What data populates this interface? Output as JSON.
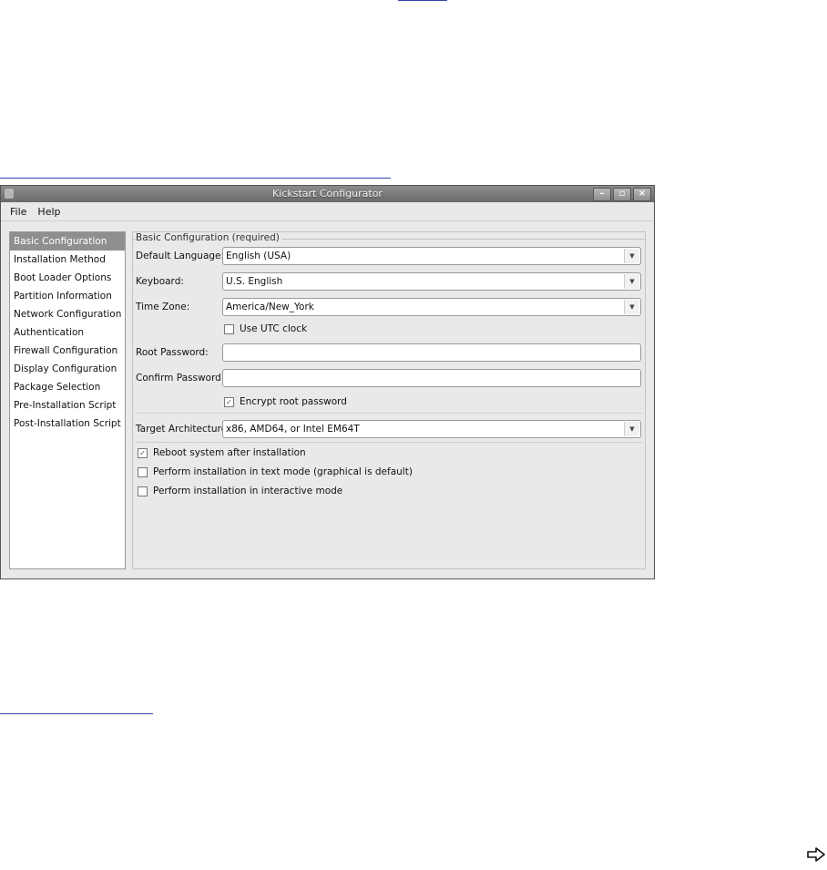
{
  "window": {
    "title": "Kickstart Configurator",
    "controls": [
      "minimize-icon",
      "maximize-icon",
      "close-icon"
    ]
  },
  "menu": {
    "file": "File",
    "help": "Help"
  },
  "sidebar": {
    "items": [
      {
        "label": "Basic Configuration",
        "selected": true
      },
      {
        "label": "Installation Method"
      },
      {
        "label": "Boot Loader Options"
      },
      {
        "label": "Partition Information"
      },
      {
        "label": "Network Configuration"
      },
      {
        "label": "Authentication"
      },
      {
        "label": "Firewall Configuration"
      },
      {
        "label": "Display Configuration"
      },
      {
        "label": "Package Selection"
      },
      {
        "label": "Pre-Installation Script"
      },
      {
        "label": "Post-Installation Script"
      }
    ]
  },
  "basic": {
    "group_title": "Basic Configuration (required)",
    "default_language": {
      "label": "Default Language:",
      "value": "English (USA)"
    },
    "keyboard": {
      "label": "Keyboard:",
      "value": "U.S. English"
    },
    "time_zone": {
      "label": "Time Zone:",
      "value": "America/New_York"
    },
    "utc_clock": {
      "label": "Use UTC clock",
      "checked": false
    },
    "root_password": {
      "label": "Root Password:",
      "value": ""
    },
    "confirm_password": {
      "label": "Confirm Password:",
      "value": ""
    },
    "encrypt_root": {
      "label": "Encrypt root password",
      "checked": true
    },
    "target_arch": {
      "label": "Target Architecture:",
      "value": "x86, AMD64, or Intel EM64T"
    },
    "reboot": {
      "label": "Reboot system after installation",
      "checked": true
    },
    "text_mode": {
      "label": "Perform installation in text mode (graphical is default)",
      "checked": false
    },
    "interactive": {
      "label": "Perform installation in interactive mode",
      "checked": false
    }
  },
  "colors": {
    "selection": "#8f8f8f",
    "link_rule": "#3344aa"
  },
  "icons": {
    "next_page": "right-arrow-icon"
  }
}
